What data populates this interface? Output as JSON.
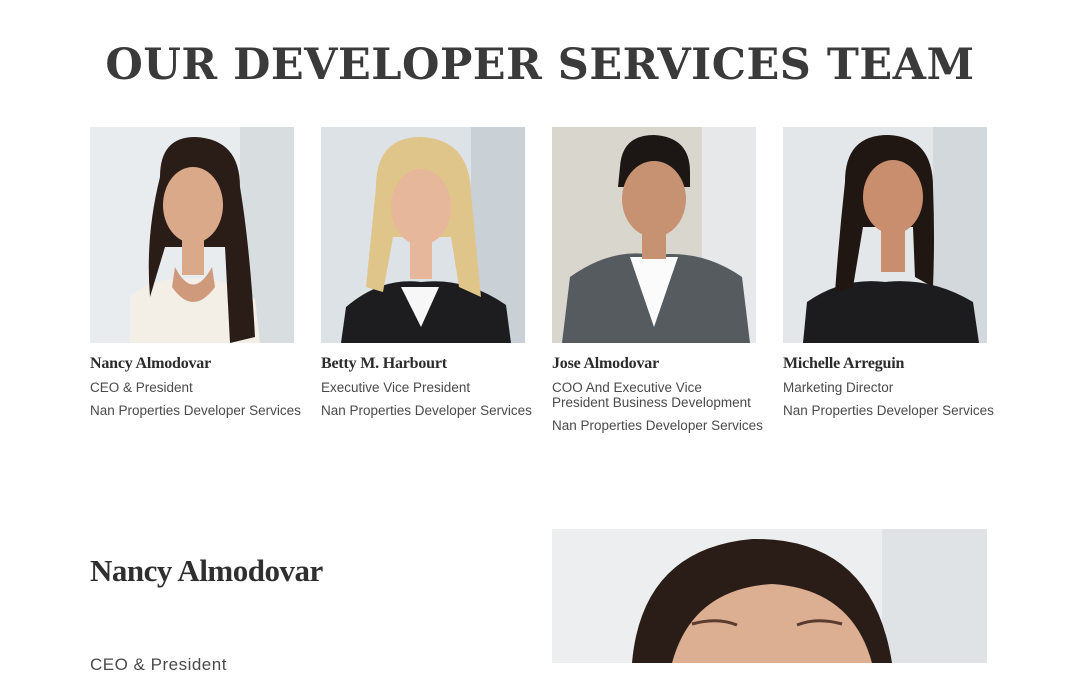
{
  "heading": "OUR DEVELOPER SERVICES TEAM",
  "team": [
    {
      "name": "Nancy Almodovar",
      "role": "CEO & President",
      "company": "Nan Properties Developer Services",
      "photo_icon": "portrait-woman-dark-hair-icon"
    },
    {
      "name": "Betty M. Harbourt",
      "role": "Executive Vice President",
      "company": "Nan Properties Developer Services",
      "photo_icon": "portrait-woman-blonde-hair-icon"
    },
    {
      "name": "Jose Almodovar",
      "role": "COO And Executive Vice President Business Development",
      "company": "Nan Properties Developer Services",
      "photo_icon": "portrait-man-gray-blazer-icon"
    },
    {
      "name": "Michelle Arreguin",
      "role": "Marketing Director",
      "company": "Nan Properties Developer Services",
      "photo_icon": "portrait-woman-dark-hair-icon"
    }
  ],
  "featured": {
    "name": "Nancy Almodovar",
    "role": "CEO & President",
    "photo_icon": "portrait-woman-dark-hair-icon"
  },
  "colors": {
    "text": "#333333",
    "background": "#ffffff"
  }
}
